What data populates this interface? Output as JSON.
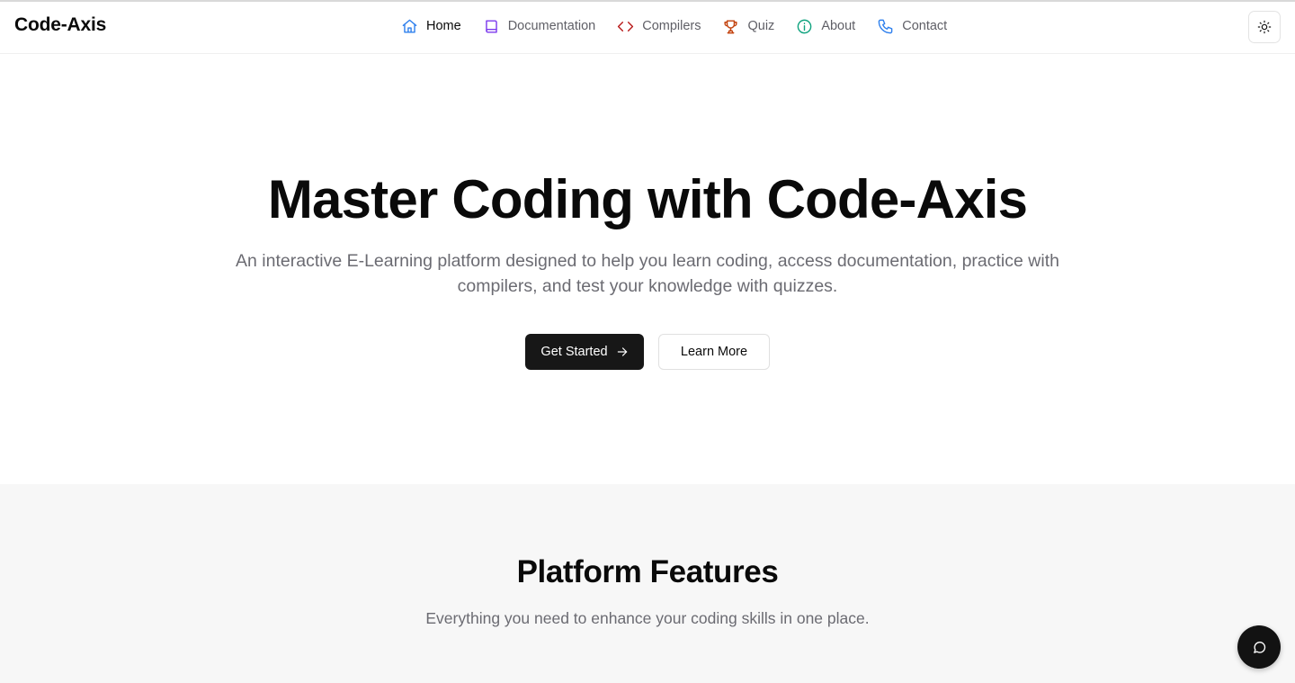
{
  "brand": "Code-Axis",
  "nav": {
    "items": [
      {
        "label": "Home",
        "icon": "home-icon",
        "color": "#2f80ed",
        "active": true
      },
      {
        "label": "Documentation",
        "icon": "book-icon",
        "color": "#7c3aed",
        "active": false
      },
      {
        "label": "Compilers",
        "icon": "code-icon",
        "color": "#b91c1c",
        "active": false
      },
      {
        "label": "Quiz",
        "icon": "trophy-icon",
        "color": "#c2410c",
        "active": false
      },
      {
        "label": "About",
        "icon": "info-icon",
        "color": "#10a37f",
        "active": false
      },
      {
        "label": "Contact",
        "icon": "phone-icon",
        "color": "#2f80ed",
        "active": false
      }
    ],
    "theme_toggle_icon": "sun-icon"
  },
  "hero": {
    "title": "Master Coding with Code-Axis",
    "subtitle": "An interactive E-Learning platform designed to help you learn coding, access documentation, practice with compilers, and test your knowledge with quizzes.",
    "primary_button": "Get Started",
    "secondary_button": "Learn More"
  },
  "features": {
    "title": "Platform Features",
    "subtitle": "Everything you need to enhance your coding skills in one place."
  },
  "chat": {
    "icon": "chat-bubble-icon"
  },
  "colors": {
    "primary": "#171717",
    "muted_text": "#6b6b72",
    "section_bg": "#f7f7f7"
  }
}
